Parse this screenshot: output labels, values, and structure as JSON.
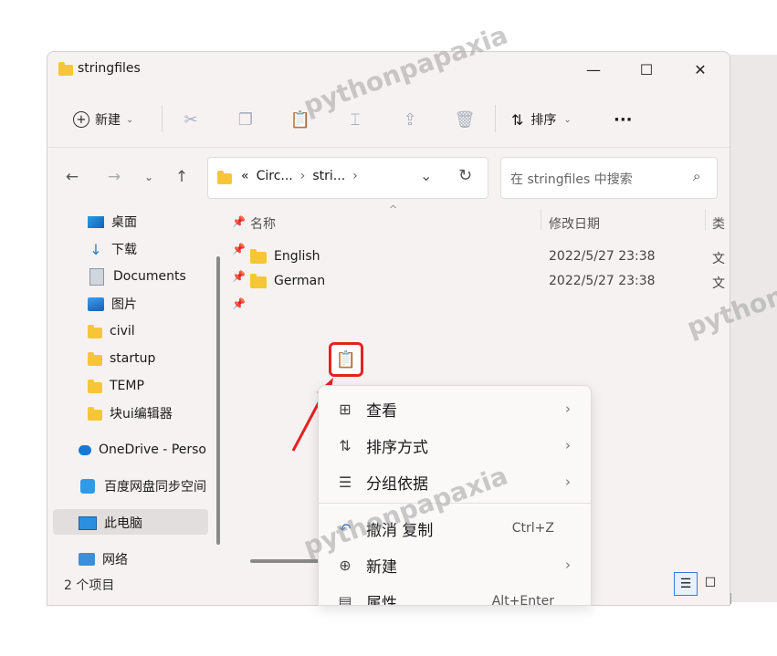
{
  "window": {
    "title": "stringfiles",
    "minimize": "—",
    "maximize": "☐",
    "close": "✕"
  },
  "toolbar": {
    "new_label": "新建",
    "sort_label": "排序",
    "more_label": "···"
  },
  "address": {
    "overflow": "«",
    "crumbs": [
      "Circ...",
      "stri..."
    ],
    "search_placeholder": "在 stringfiles 中搜索"
  },
  "sidebar": {
    "items": [
      {
        "label": "桌面",
        "icon": "desktop-icon",
        "pinned": true
      },
      {
        "label": "下载",
        "icon": "download-icon",
        "pinned": true
      },
      {
        "label": "Documents",
        "icon": "documents-icon",
        "pinned": true
      },
      {
        "label": "图片",
        "icon": "pictures-icon",
        "pinned": true
      },
      {
        "label": "civil",
        "icon": "folder-icon",
        "pinned": false
      },
      {
        "label": "startup",
        "icon": "folder-icon",
        "pinned": false
      },
      {
        "label": "TEMP",
        "icon": "folder-icon",
        "pinned": false
      },
      {
        "label": "块ui编辑器",
        "icon": "folder-icon",
        "pinned": false
      },
      {
        "label": "OneDrive - Perso",
        "icon": "onedrive-icon",
        "pinned": false
      },
      {
        "label": "百度网盘同步空间",
        "icon": "baidu-icon",
        "pinned": false
      },
      {
        "label": "此电脑",
        "icon": "pc-icon",
        "pinned": false
      },
      {
        "label": "网络",
        "icon": "network-icon",
        "pinned": false
      }
    ]
  },
  "columns": {
    "name": "名称",
    "date": "修改日期",
    "type": "类"
  },
  "files": [
    {
      "name": "English",
      "date": "2022/5/27 23:38",
      "type": "文"
    },
    {
      "name": "German",
      "date": "2022/5/27 23:38",
      "type": "文"
    }
  ],
  "status": {
    "count": "2 个项目"
  },
  "context_menu": {
    "items": [
      {
        "label": "查看",
        "icon": "view-grid-icon",
        "submenu": true,
        "shortcut": ""
      },
      {
        "label": "排序方式",
        "icon": "sort-icon",
        "submenu": true,
        "shortcut": ""
      },
      {
        "label": "分组依据",
        "icon": "group-icon",
        "submenu": true,
        "shortcut": ""
      },
      {
        "label": "撤消 复制",
        "icon": "undo-icon",
        "submenu": false,
        "shortcut": "Ctrl+Z"
      },
      {
        "label": "新建",
        "icon": "new-icon",
        "submenu": true,
        "shortcut": ""
      },
      {
        "label": "属性",
        "icon": "properties-icon",
        "submenu": false,
        "shortcut": "Alt+Enter"
      }
    ]
  },
  "watermark": "pythonpapaxia",
  "colors": {
    "accent": "#0067c0",
    "highlight": "#e52222",
    "folder": "#f6c636"
  }
}
